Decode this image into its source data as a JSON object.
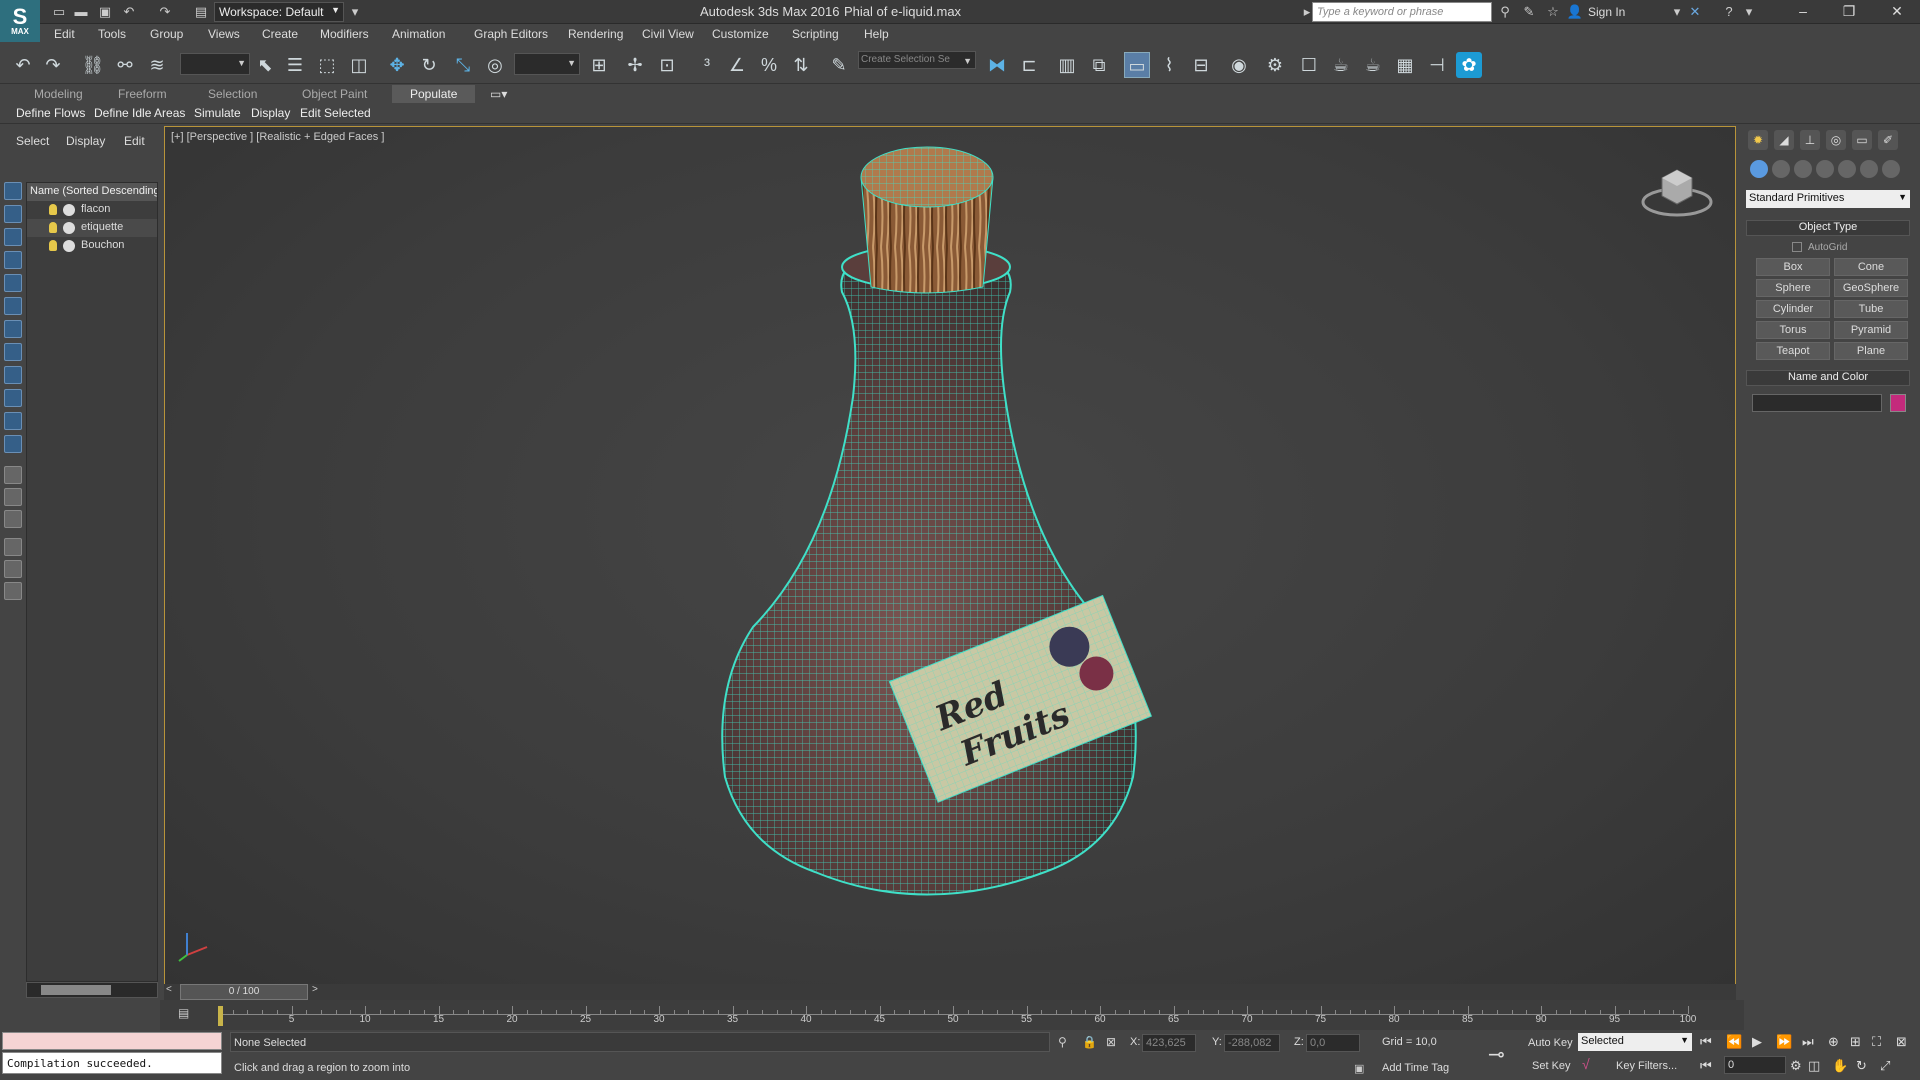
{
  "window": {
    "app_title": "Autodesk 3ds Max 2016",
    "file_name": "Phial of e-liquid.max",
    "workspace": "Workspace: Default",
    "search_placeholder": "Type a keyword or phrase",
    "sign_in": "Sign In",
    "logo_text": "MAX"
  },
  "menu": [
    "Edit",
    "Tools",
    "Group",
    "Views",
    "Create",
    "Modifiers",
    "Animation",
    "Graph Editors",
    "Rendering",
    "Civil View",
    "Customize",
    "Scripting",
    "Help"
  ],
  "toolbar": {
    "selection_set_placeholder": "Create Selection Se"
  },
  "ribbon": {
    "tabs": [
      "Modeling",
      "Freeform",
      "Selection",
      "Object Paint",
      "Populate"
    ],
    "active_tab": "Populate",
    "buttons": [
      "Define Flows",
      "Define Idle Areas",
      "Simulate",
      "Display",
      "Edit Selected"
    ]
  },
  "scene_explorer": {
    "tabs": [
      "Select",
      "Display",
      "Edit"
    ],
    "column_header": "Name (Sorted Descending)",
    "items": [
      "flacon",
      "etiquette",
      "Bouchon"
    ]
  },
  "viewport": {
    "label": "[+] [Perspective ] [Realistic + Edged Faces ]",
    "label_text_on_object": [
      "Red",
      "Fruits"
    ]
  },
  "time": {
    "slider": "0 / 100",
    "ticks": [
      "5",
      "10",
      "15",
      "20",
      "25",
      "30",
      "35",
      "40",
      "45",
      "50",
      "55",
      "60",
      "65",
      "70",
      "75",
      "80",
      "85",
      "90",
      "95",
      "100"
    ]
  },
  "command_panel": {
    "category": "Standard Primitives",
    "object_type_rollout": "Object Type",
    "autogrid": "AutoGrid",
    "primitives": [
      "Box",
      "Cone",
      "Sphere",
      "GeoSphere",
      "Cylinder",
      "Tube",
      "Torus",
      "Pyramid",
      "Teapot",
      "Plane"
    ],
    "name_color_rollout": "Name and Color",
    "object_color": "#c42a7c"
  },
  "status": {
    "listener": "Compilation succeeded.",
    "selection": "None Selected",
    "prompt": "Click and drag a region to zoom into",
    "x_label": "X:",
    "x": "423,625",
    "y_label": "Y:",
    "y": "-288,082",
    "z_label": "Z:",
    "z": "0,0",
    "grid": "Grid = 10,0",
    "add_time_tag": "Add Time Tag",
    "auto_key": "Auto Key",
    "set_key": "Set Key",
    "key_mode": "Selected",
    "key_filters": "Key Filters...",
    "frame": "0"
  }
}
